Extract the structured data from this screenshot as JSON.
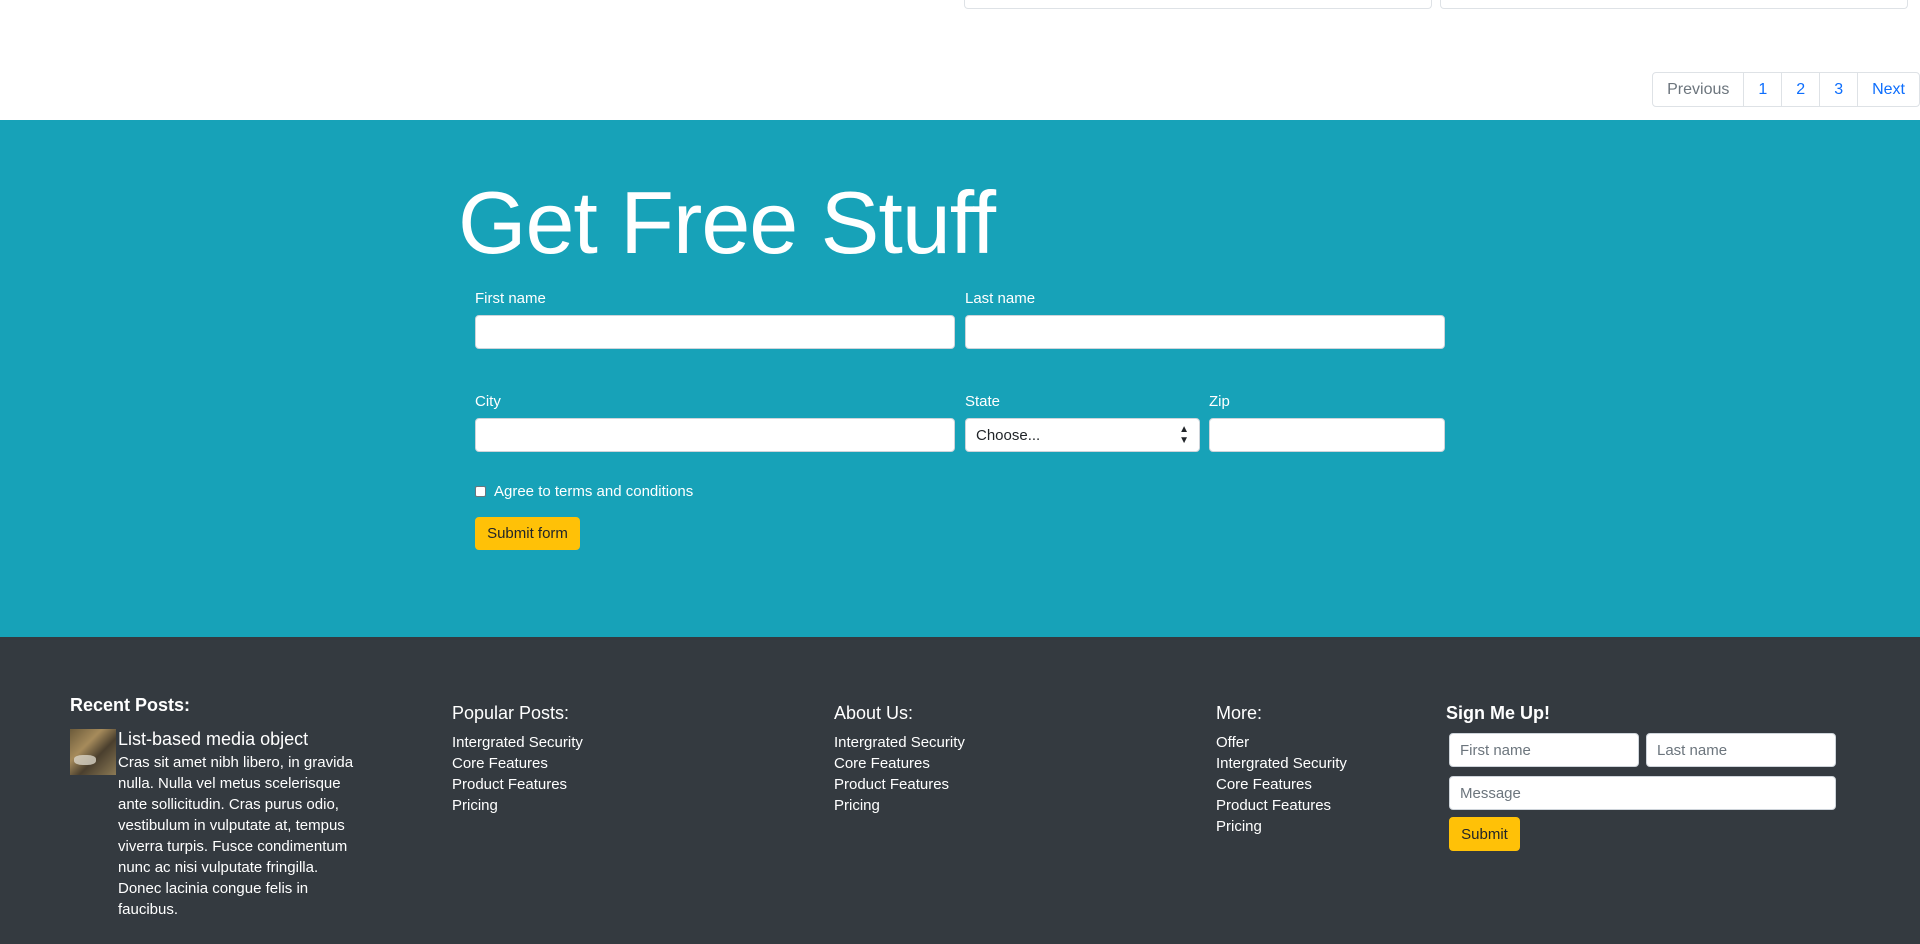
{
  "pagination": {
    "previous": "Previous",
    "pages": [
      "1",
      "2",
      "3"
    ],
    "next": "Next"
  },
  "hero": {
    "title": "Get Free Stuff",
    "first_name_label": "First name",
    "last_name_label": "Last name",
    "city_label": "City",
    "state_label": "State",
    "state_value": "Choose...",
    "zip_label": "Zip",
    "agree_label": "Agree to terms and conditions",
    "submit_label": "Submit form"
  },
  "footer": {
    "recent_posts": {
      "heading": "Recent Posts:",
      "title": "List-based media object",
      "text": "Cras sit amet nibh libero, in gravida nulla. Nulla vel metus scelerisque ante sollicitudin. Cras purus odio, vestibulum in vulputate at, tempus viverra turpis. Fusce condimentum nunc ac nisi vulputate fringilla. Donec lacinia congue felis in faucibus."
    },
    "popular_posts": {
      "heading": "Popular Posts:",
      "items": [
        "Intergrated Security",
        "Core Features",
        "Product Features",
        "Pricing"
      ]
    },
    "about_us": {
      "heading": "About Us:",
      "items": [
        "Intergrated Security",
        "Core Features",
        "Product Features",
        "Pricing"
      ]
    },
    "more": {
      "heading": "More:",
      "items": [
        "Offer",
        "Intergrated Security",
        "Core Features",
        "Product Features",
        "Pricing"
      ]
    },
    "sign_up": {
      "heading": "Sign Me Up!",
      "first_name_placeholder": "First name",
      "last_name_placeholder": "Last name",
      "message_placeholder": "Message",
      "submit_label": "Submit"
    }
  },
  "colors": {
    "hero_bg": "#17a2b8",
    "footer_bg": "#343a40",
    "button_warning": "#ffc107",
    "link": "#0d6efd"
  }
}
